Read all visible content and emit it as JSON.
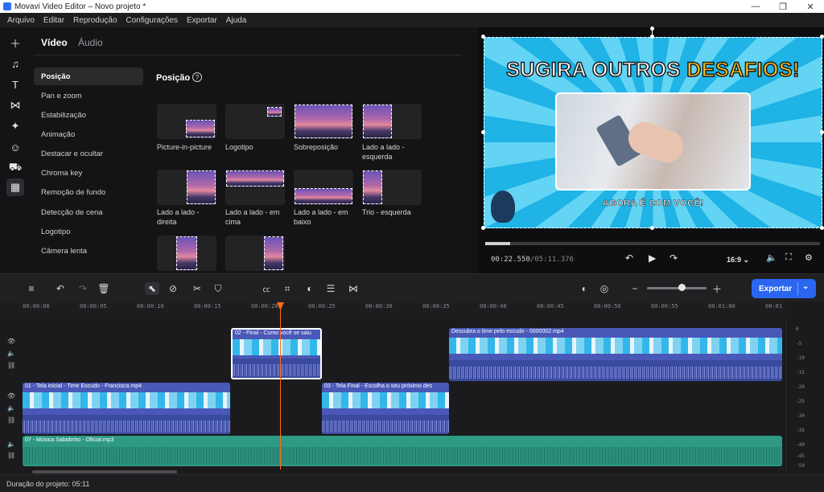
{
  "window": {
    "title": "Movavi Video Editor – Novo projeto *"
  },
  "menu": [
    "Arquivo",
    "Editar",
    "Reprodução",
    "Configurações",
    "Exportar",
    "Ajuda"
  ],
  "props": {
    "tabs": [
      "Vídeo",
      "Áudio"
    ],
    "nav": [
      "Posição",
      "Pan e zoom",
      "Estabilização",
      "Animação",
      "Destacar e ocultar",
      "Chroma key",
      "Remoção de fundo",
      "Detecção de cena",
      "Logotipo",
      "Câmera lenta"
    ],
    "section_title": "Posição",
    "tiles": [
      "Picture-in-picture",
      "Logotipo",
      "Sobreposição",
      "Lado a lado - esquerda",
      "Lado a lado - direita",
      "Lado a lado - em cima",
      "Lado a lado - em baixo",
      "Trio - esquerda"
    ]
  },
  "preview": {
    "title_main": "SUGIRA OUTROS ",
    "title_highlight": "DESAFIOS!",
    "subtitle": "AGORA É COM VOCÊ!",
    "time_current": "00:22.550",
    "time_total": "/05:11.376",
    "aspect": "16:9",
    "progress": 0.074
  },
  "toolbar": {
    "export_label": "Exportar"
  },
  "ruler": [
    "00:00:00",
    "00:00:05",
    "00:00:10",
    "00:00:15",
    "00:00:20",
    "00:00:25",
    "00:00:30",
    "00:00:35",
    "00:00:40",
    "00:00:45",
    "00:00:50",
    "00:00:55",
    "00:01:00",
    "00:01"
  ],
  "clips": {
    "c1": "02 - Final - Como você se saiu",
    "c2": "Descubra o time pelo escudo - 0000002.mp4",
    "c3": "01 - Tela inicial - Time Escudo - Francisca.mp4",
    "c4": "03 - Tela Final - Escolha o seu próximo des",
    "music": "07 - Música Sabidinho - Oficial.mp3"
  },
  "meter": [
    "0",
    "-5",
    "-10",
    "-15",
    "-20",
    "-25",
    "-30",
    "-35",
    "-40",
    "-45",
    "-50"
  ],
  "status": {
    "duration": "Duração do projeto: 05:11"
  },
  "colors": {
    "accent": "#2a66f0",
    "playhead": "#ff6a1a",
    "clip": "#4a58b8",
    "music": "#2e9a83"
  }
}
